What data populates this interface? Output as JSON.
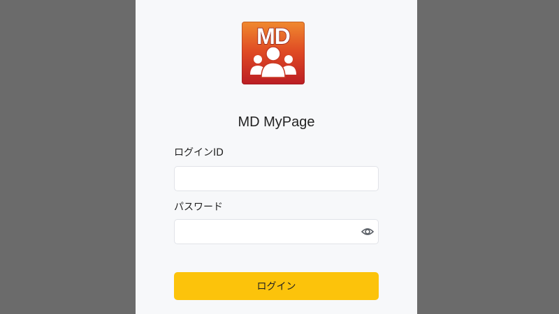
{
  "logo": {
    "text": "MD",
    "colors": {
      "top": "#f08a2f",
      "middle": "#df4a24",
      "bottom": "#bb1e24"
    }
  },
  "app_title": "MD MyPage",
  "login_form": {
    "login_id_label": "ログインID",
    "login_id_value": "",
    "password_label": "パスワード",
    "password_value": "",
    "password_toggle_icon": "eye-icon",
    "submit_label": "ログイン"
  },
  "colors": {
    "backdrop": "#6b6b6b",
    "panel": "#f7f8fa",
    "button": "#fcc30b"
  }
}
